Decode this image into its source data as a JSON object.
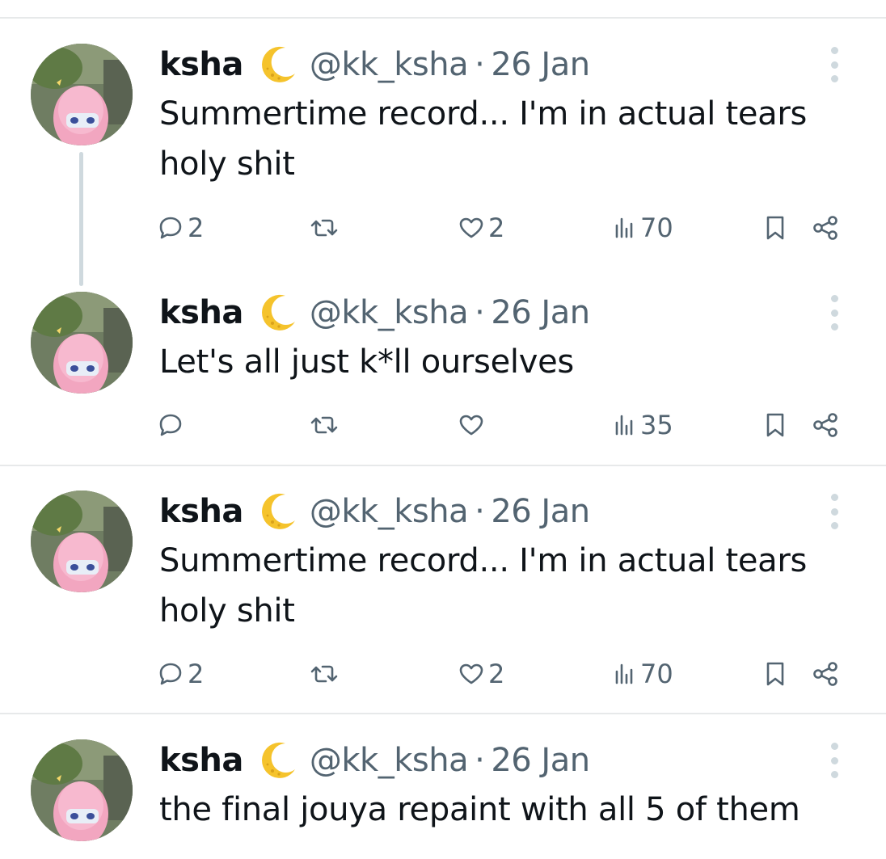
{
  "tweets": [
    {
      "name": "ksha",
      "handle": "@kk_ksha",
      "separator": "·",
      "date": "26 Jan",
      "text_lines": [
        "Summertime record... I'm in actual tears",
        "holy shit"
      ],
      "replies": "2",
      "retweets": "",
      "likes": "2",
      "views": "70"
    },
    {
      "name": "ksha",
      "handle": "@kk_ksha",
      "separator": "·",
      "date": "26 Jan",
      "text_lines": [
        "Let's all just k*ll ourselves"
      ],
      "replies": "",
      "retweets": "",
      "likes": "",
      "views": "35"
    },
    {
      "name": "ksha",
      "handle": "@kk_ksha",
      "separator": "·",
      "date": "26 Jan",
      "text_lines": [
        "Summertime record... I'm in actual tears",
        "holy shit"
      ],
      "replies": "2",
      "retweets": "",
      "likes": "2",
      "views": "70"
    },
    {
      "name": "ksha",
      "handle": "@kk_ksha",
      "separator": "·",
      "date": "26 Jan",
      "text_lines": [
        "the final jouya repaint with all 5 of them"
      ]
    }
  ],
  "icons": {
    "reply": "reply-icon",
    "retweet": "retweet-icon",
    "like": "heart-icon",
    "views": "views-icon",
    "bookmark": "bookmark-icon",
    "share": "share-icon",
    "more": "more-options-icon",
    "badge": "crescent-moon-icon"
  },
  "colors": {
    "text": "#0f1419",
    "secondary": "#536471",
    "divider": "#e7e9ea",
    "moon": "#f5c32c",
    "avatar_hair": "#f2a6c0"
  }
}
